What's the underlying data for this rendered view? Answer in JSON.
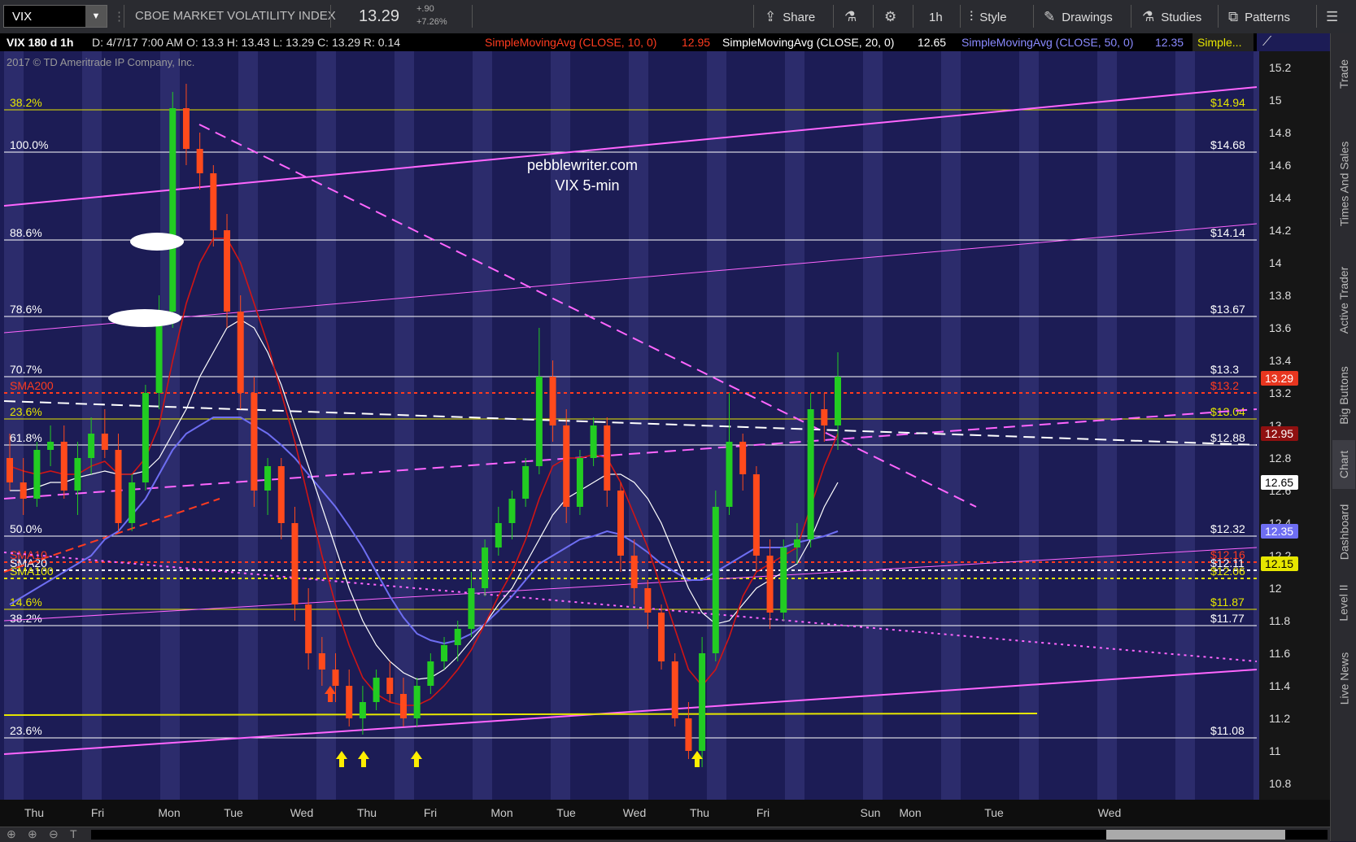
{
  "toolbar": {
    "symbol": "VIX",
    "title": "CBOE MARKET VOLATILITY INDEX",
    "last": "13.29",
    "change": "+.90",
    "change_pct": "+7.26%",
    "share": "Share",
    "timeframe": "1h",
    "style": "Style",
    "drawings": "Drawings",
    "studies": "Studies",
    "patterns": "Patterns"
  },
  "header": {
    "info": "VIX 180 d 1h",
    "stats": "D: 4/7/17 7:00 AM  O: 13.3  H: 13.43  L: 13.29  C: 13.29  R: 0.14",
    "sma10": "SimpleMovingAvg (CLOSE, 10, 0)",
    "sma10_val": "12.95",
    "sma20": "SimpleMovingAvg (CLOSE, 20, 0)",
    "sma20_val": "12.65",
    "sma50": "SimpleMovingAvg (CLOSE, 50, 0)",
    "sma50_val": "12.35",
    "more": "Simple...",
    "copyright": "2017 © TD Ameritrade IP Company, Inc."
  },
  "annotation": {
    "line1": "pebblewriter.com",
    "line2": "VIX 5-min"
  },
  "right_tabs": [
    "Trade",
    "Times And Sales",
    "Active Trader",
    "Big Buttons",
    "Chart",
    "Dashboard",
    "Level II",
    "Live News"
  ],
  "chart_data": {
    "type": "candlestick",
    "ylim": [
      10.7,
      15.3
    ],
    "y_ticks": [
      10.8,
      11,
      11.2,
      11.4,
      11.6,
      11.8,
      12,
      12.2,
      12.4,
      12.6,
      12.8,
      13,
      13.2,
      13.4,
      13.6,
      13.8,
      14,
      14.2,
      14.4,
      14.6,
      14.8,
      15,
      15.2
    ],
    "x_labels": [
      "Thu",
      "Fri",
      "Mon",
      "Tue",
      "Wed",
      "Thu",
      "Fri",
      "Mon",
      "Tue",
      "Wed",
      "Thu",
      "Fri",
      "Sun",
      "Mon",
      "Tue",
      "Wed"
    ],
    "levels": [
      {
        "label": "38.2%",
        "value": 14.94,
        "right": "$14.94",
        "color": "#e6e600"
      },
      {
        "label": "100.0%",
        "value": 14.68,
        "right": "$14.68",
        "color": "#ffffff"
      },
      {
        "label": "88.6%",
        "value": 14.14,
        "right": "$14.14",
        "color": "#ffffff"
      },
      {
        "label": "78.6%",
        "value": 13.67,
        "right": "$13.67",
        "color": "#ffffff"
      },
      {
        "label": "70.7%",
        "value": 13.3,
        "right": "$13.3",
        "color": "#ffffff"
      },
      {
        "label": "SMA200",
        "value": 13.2,
        "right": "$13.2",
        "color": "#ff3b1f"
      },
      {
        "label": "23.6%",
        "value": 13.04,
        "right": "$13.04",
        "color": "#e6e600"
      },
      {
        "label": "61.8%",
        "value": 12.88,
        "right": "$12.88",
        "color": "#ffffff"
      },
      {
        "label": "50.0%",
        "value": 12.32,
        "right": "$12.32",
        "color": "#ffffff"
      },
      {
        "label": "SMA10",
        "value": 12.16,
        "right": "$12.16",
        "color": "#ff3b1f"
      },
      {
        "label": "SMA20",
        "value": 12.11,
        "right": "$12.11",
        "color": "#ffffff"
      },
      {
        "label": "SMA100",
        "value": 12.06,
        "right": "$12.06",
        "color": "#e6e600"
      },
      {
        "label": "14.6%",
        "value": 11.87,
        "right": "$11.87",
        "color": "#e6e600"
      },
      {
        "label": "38.2%",
        "value": 11.77,
        "right": "$11.77",
        "color": "#ffffff"
      },
      {
        "label": "23.6%",
        "value": 11.08,
        "right": "$11.08",
        "color": "#ffffff"
      }
    ],
    "price_tags": [
      {
        "value": 13.29,
        "text": "13.29",
        "bg": "#e8361f",
        "fg": "#ffffff"
      },
      {
        "value": 12.95,
        "text": "12.95",
        "bg": "#8f1010",
        "fg": "#ffffff"
      },
      {
        "value": 12.65,
        "text": "12.65",
        "bg": "#ffffff",
        "fg": "#000000"
      },
      {
        "value": 12.35,
        "text": "12.35",
        "bg": "#6e6ef2",
        "fg": "#ffffff"
      },
      {
        "value": 12.15,
        "text": "12.15",
        "bg": "#e6e600",
        "fg": "#000000"
      }
    ],
    "ohlc": [
      [
        12.8,
        12.95,
        12.6,
        12.65
      ],
      [
        12.65,
        12.8,
        12.45,
        12.55
      ],
      [
        12.55,
        12.9,
        12.5,
        12.85
      ],
      [
        12.85,
        13.0,
        12.75,
        12.9
      ],
      [
        12.9,
        13.0,
        12.55,
        12.6
      ],
      [
        12.6,
        12.9,
        12.45,
        12.8
      ],
      [
        12.8,
        13.05,
        12.7,
        12.95
      ],
      [
        12.95,
        13.1,
        12.8,
        12.85
      ],
      [
        12.85,
        12.95,
        12.35,
        12.4
      ],
      [
        12.4,
        12.7,
        12.35,
        12.65
      ],
      [
        12.65,
        13.25,
        12.6,
        13.2
      ],
      [
        13.2,
        13.8,
        13.1,
        13.7
      ],
      [
        13.7,
        15.05,
        13.6,
        14.95
      ],
      [
        14.95,
        15.1,
        14.6,
        14.7
      ],
      [
        14.7,
        14.8,
        14.45,
        14.55
      ],
      [
        14.55,
        14.6,
        14.1,
        14.2
      ],
      [
        14.2,
        14.3,
        13.6,
        13.7
      ],
      [
        13.7,
        13.8,
        13.1,
        13.2
      ],
      [
        13.2,
        13.3,
        12.5,
        12.6
      ],
      [
        12.6,
        12.8,
        12.45,
        12.75
      ],
      [
        12.75,
        12.8,
        12.3,
        12.4
      ],
      [
        12.4,
        12.5,
        11.8,
        11.9
      ],
      [
        11.9,
        12.0,
        11.5,
        11.6
      ],
      [
        11.6,
        11.7,
        11.4,
        11.5
      ],
      [
        11.5,
        11.6,
        11.3,
        11.4
      ],
      [
        11.4,
        11.5,
        11.15,
        11.2
      ],
      [
        11.2,
        11.4,
        11.1,
        11.3
      ],
      [
        11.3,
        11.5,
        11.25,
        11.45
      ],
      [
        11.45,
        11.55,
        11.3,
        11.35
      ],
      [
        11.35,
        11.45,
        11.15,
        11.2
      ],
      [
        11.2,
        11.45,
        11.15,
        11.4
      ],
      [
        11.4,
        11.6,
        11.35,
        11.55
      ],
      [
        11.55,
        11.7,
        11.5,
        11.65
      ],
      [
        11.65,
        11.8,
        11.55,
        11.75
      ],
      [
        11.75,
        12.1,
        11.7,
        12.0
      ],
      [
        12.0,
        12.3,
        11.95,
        12.25
      ],
      [
        12.25,
        12.5,
        12.2,
        12.4
      ],
      [
        12.4,
        12.6,
        12.3,
        12.55
      ],
      [
        12.55,
        12.8,
        12.5,
        12.75
      ],
      [
        12.75,
        13.6,
        12.7,
        13.3
      ],
      [
        13.3,
        13.4,
        12.9,
        13.0
      ],
      [
        13.0,
        13.1,
        12.4,
        12.5
      ],
      [
        12.5,
        12.85,
        12.45,
        12.8
      ],
      [
        12.8,
        13.05,
        12.75,
        13.0
      ],
      [
        13.0,
        13.05,
        12.5,
        12.6
      ],
      [
        12.6,
        12.65,
        12.1,
        12.2
      ],
      [
        12.2,
        12.3,
        11.9,
        12.0
      ],
      [
        12.0,
        12.05,
        11.75,
        11.85
      ],
      [
        11.85,
        11.9,
        11.5,
        11.55
      ],
      [
        11.55,
        11.6,
        11.15,
        11.2
      ],
      [
        11.2,
        11.3,
        10.95,
        11.0
      ],
      [
        11.0,
        11.7,
        10.9,
        11.6
      ],
      [
        11.6,
        12.6,
        11.55,
        12.5
      ],
      [
        12.5,
        13.2,
        12.45,
        12.9
      ],
      [
        12.9,
        12.95,
        12.6,
        12.7
      ],
      [
        12.7,
        12.75,
        12.1,
        12.2
      ],
      [
        12.2,
        12.3,
        11.75,
        11.85
      ],
      [
        11.85,
        12.3,
        11.8,
        12.25
      ],
      [
        12.25,
        12.4,
        12.15,
        12.3
      ],
      [
        12.3,
        13.2,
        12.25,
        13.1
      ],
      [
        13.1,
        13.2,
        12.9,
        13.0
      ],
      [
        13.0,
        13.45,
        12.85,
        13.3
      ]
    ],
    "sma10": [
      12.75,
      12.72,
      12.7,
      12.72,
      12.7,
      12.7,
      12.75,
      12.78,
      12.7,
      12.7,
      12.8,
      13.0,
      13.4,
      13.75,
      14.0,
      14.15,
      14.15,
      14.0,
      13.75,
      13.5,
      13.2,
      12.9,
      12.55,
      12.2,
      11.9,
      11.65,
      11.45,
      11.35,
      11.3,
      11.28,
      11.28,
      11.32,
      11.4,
      11.5,
      11.62,
      11.78,
      11.95,
      12.1,
      12.3,
      12.55,
      12.75,
      12.8,
      12.8,
      12.82,
      12.8,
      12.65,
      12.45,
      12.25,
      12.0,
      11.75,
      11.5,
      11.4,
      11.5,
      11.7,
      11.95,
      12.1,
      12.15,
      12.2,
      12.25,
      12.5,
      12.75,
      12.95
    ],
    "sma20": [
      12.6,
      12.6,
      12.62,
      12.65,
      12.65,
      12.68,
      12.7,
      12.72,
      12.7,
      12.7,
      12.72,
      12.8,
      12.95,
      13.1,
      13.3,
      13.45,
      13.6,
      13.65,
      13.6,
      13.45,
      13.25,
      13.0,
      12.75,
      12.5,
      12.25,
      12.0,
      11.8,
      11.65,
      11.55,
      11.48,
      11.44,
      11.45,
      11.5,
      11.58,
      11.68,
      11.78,
      11.9,
      12.0,
      12.15,
      12.3,
      12.45,
      12.55,
      12.6,
      12.65,
      12.7,
      12.7,
      12.65,
      12.55,
      12.4,
      12.2,
      12.0,
      11.85,
      11.78,
      11.8,
      11.9,
      12.0,
      12.05,
      12.1,
      12.15,
      12.3,
      12.5,
      12.65
    ],
    "sma50": [
      11.9,
      11.95,
      12.0,
      12.05,
      12.1,
      12.15,
      12.2,
      12.3,
      12.35,
      12.45,
      12.55,
      12.7,
      12.85,
      12.95,
      13.0,
      13.05,
      13.05,
      13.05,
      13.0,
      12.95,
      12.88,
      12.8,
      12.7,
      12.6,
      12.5,
      12.38,
      12.25,
      12.1,
      11.95,
      11.82,
      11.72,
      11.68,
      11.66,
      11.68,
      11.72,
      11.78,
      11.86,
      11.95,
      12.05,
      12.15,
      12.2,
      12.25,
      12.3,
      12.32,
      12.35,
      12.33,
      12.28,
      12.22,
      12.15,
      12.1,
      12.05,
      12.05,
      12.1,
      12.15,
      12.2,
      12.25,
      12.25,
      12.25,
      12.28,
      12.3,
      12.32,
      12.35
    ]
  }
}
